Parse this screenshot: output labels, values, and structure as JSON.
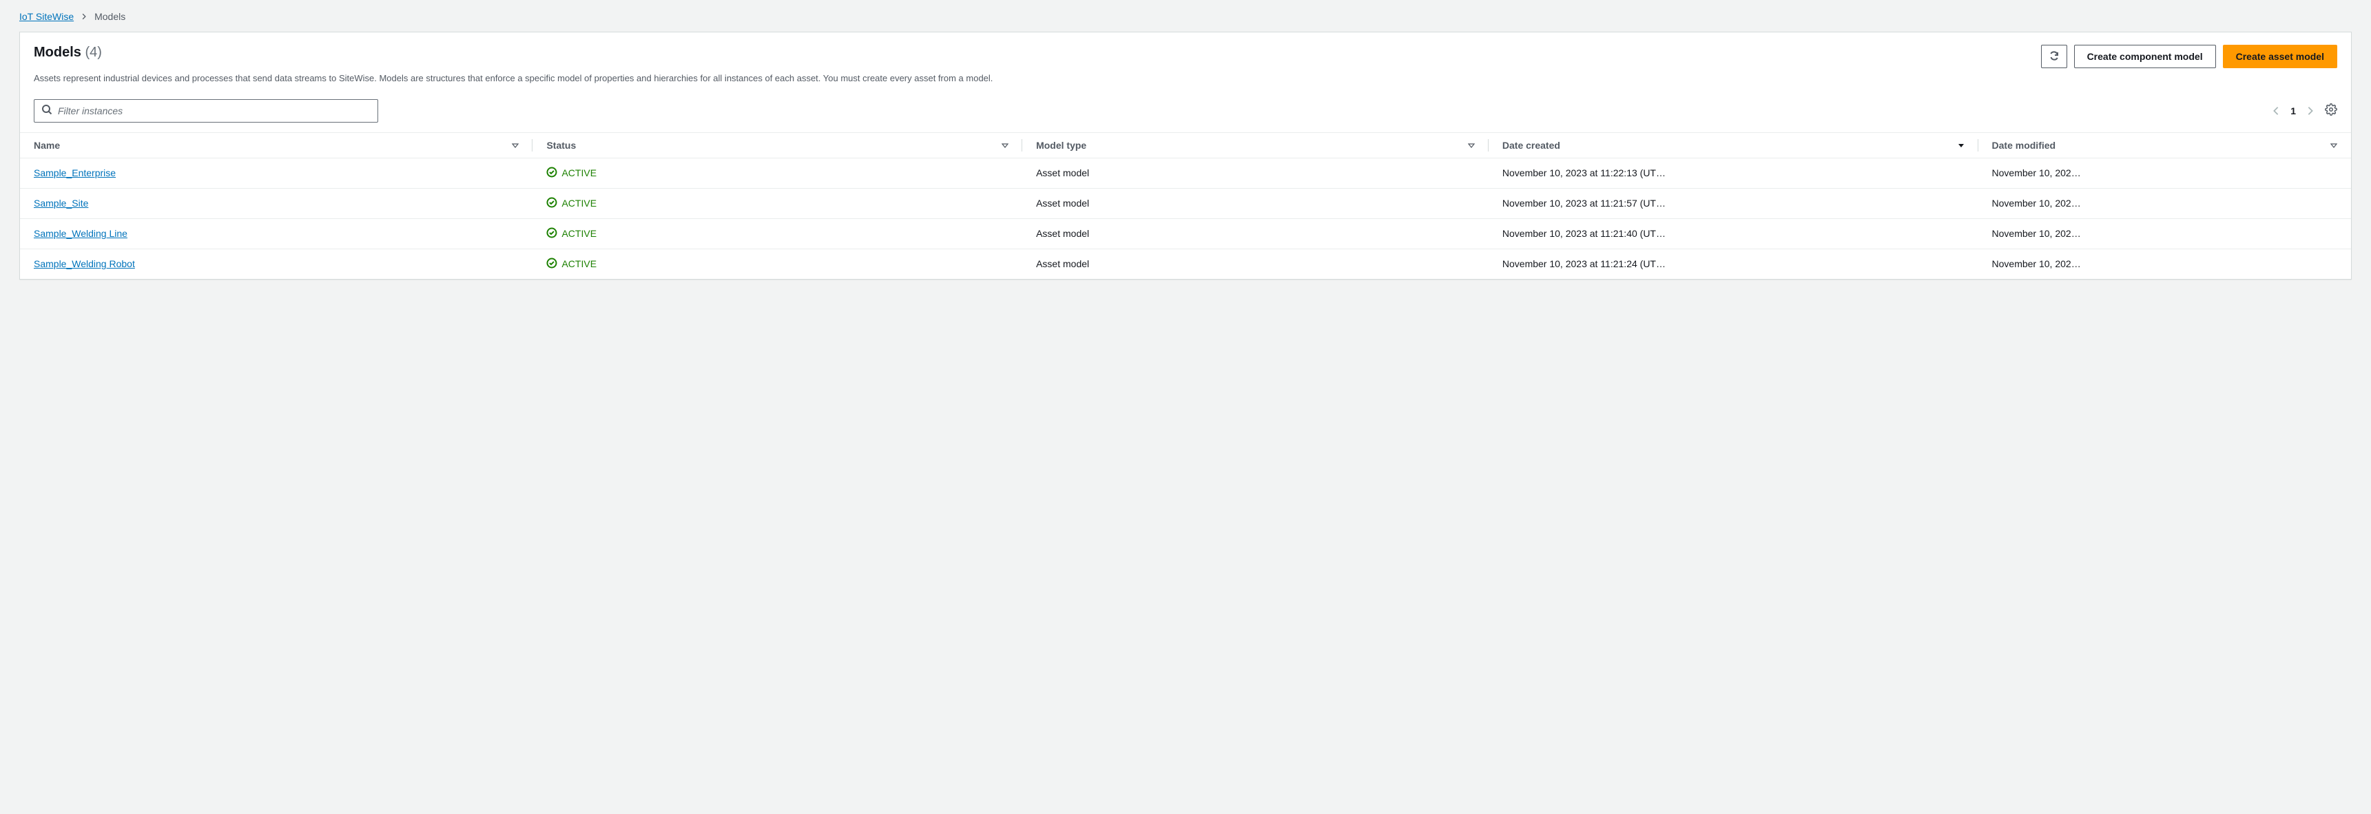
{
  "breadcrumb": {
    "root": "IoT SiteWise",
    "current": "Models"
  },
  "header": {
    "title": "Models",
    "count": "(4)",
    "description": "Assets represent industrial devices and processes that send data streams to SiteWise. Models are structures that enforce a specific model of properties and hierarchies for all instances of each asset. You must create every asset from a model.",
    "create_component_label": "Create component model",
    "create_asset_label": "Create asset model"
  },
  "search": {
    "placeholder": "Filter instances"
  },
  "pager": {
    "page": "1"
  },
  "columns": {
    "name": "Name",
    "status": "Status",
    "model_type": "Model type",
    "date_created": "Date created",
    "date_modified": "Date modified"
  },
  "rows": [
    {
      "name": "Sample_Enterprise",
      "status": "ACTIVE",
      "model_type": "Asset model",
      "date_created": "November 10, 2023 at 11:22:13 (UT…",
      "date_modified": "November 10, 202…"
    },
    {
      "name": "Sample_Site",
      "status": "ACTIVE",
      "model_type": "Asset model",
      "date_created": "November 10, 2023 at 11:21:57 (UT…",
      "date_modified": "November 10, 202…"
    },
    {
      "name": "Sample_Welding Line",
      "status": "ACTIVE",
      "model_type": "Asset model",
      "date_created": "November 10, 2023 at 11:21:40 (UT…",
      "date_modified": "November 10, 202…"
    },
    {
      "name": "Sample_Welding Robot",
      "status": "ACTIVE",
      "model_type": "Asset model",
      "date_created": "November 10, 2023 at 11:21:24 (UT…",
      "date_modified": "November 10, 202…"
    }
  ]
}
